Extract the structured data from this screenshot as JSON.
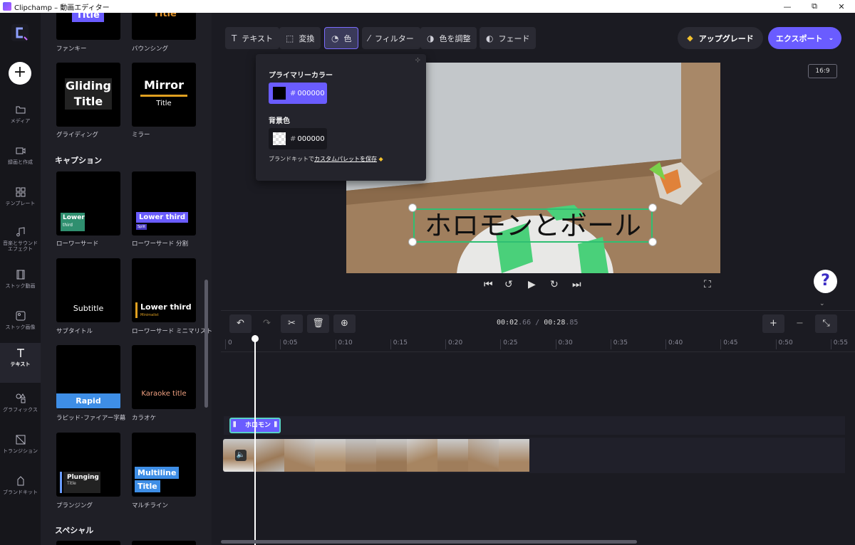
{
  "window": {
    "title": "Clipchamp – 動画エディター",
    "minimize": "—",
    "maximize": "⧉",
    "close": "✕"
  },
  "rail": {
    "add": "+",
    "items": [
      {
        "label": "メディア",
        "icon": "folder-icon"
      },
      {
        "label": "録画と作成",
        "icon": "video-camera-icon"
      },
      {
        "label": "テンプレート",
        "icon": "template-grid-icon"
      },
      {
        "label": "音楽とサウンド エフェクト",
        "icon": "music-note-icon"
      },
      {
        "label": "ストック動画",
        "icon": "film-icon"
      },
      {
        "label": "ストック画像",
        "icon": "image-icon"
      },
      {
        "label": "テキスト",
        "icon": "text-t-icon"
      },
      {
        "label": "グラフィックス",
        "icon": "shapes-icon"
      },
      {
        "label": "トランジション",
        "icon": "transition-icon"
      },
      {
        "label": "ブランドキット",
        "icon": "brand-kit-icon"
      }
    ]
  },
  "library": {
    "cards": [
      {
        "label": "ファンキー",
        "preview": "Title"
      },
      {
        "label": "バウンシング",
        "preview": "Title"
      },
      {
        "label": "グライディング",
        "preview": "Gliding Title"
      },
      {
        "label": "ミラー",
        "preview": "Mirror",
        "sub": "Title"
      },
      {
        "label": "ローワーサード",
        "preview": "Lower",
        "sub": "third"
      },
      {
        "label": "ローワーサード 分割",
        "preview": "Lower third",
        "sub": "Split"
      },
      {
        "label": "サブタイトル",
        "preview": "Subtitle"
      },
      {
        "label": "ローワーサード ミニマリスト",
        "preview": "Lower third",
        "sub": "Minimalist"
      },
      {
        "label": "ラピッド･ファイアー字幕",
        "preview": "Rapid"
      },
      {
        "label": "カラオケ",
        "preview": "Karaoke title"
      },
      {
        "label": "プランジング",
        "preview": "Plunging",
        "sub": "Title"
      },
      {
        "label": "マルチライン",
        "preview": "Multiline",
        "sub": "Title"
      }
    ],
    "section_captions": "キャプション",
    "section_special": "スペシャル"
  },
  "toolbar": {
    "text": "テキスト",
    "transform": "変換",
    "color": "色",
    "filter": "フィルター",
    "adjust": "色を調整",
    "fade": "フェード",
    "upgrade": "アップグレード",
    "export": "エクスポート"
  },
  "aspect_ratio": "16:9",
  "color_popover": {
    "primary_label": "プライマリーカラー",
    "primary_value": "000000",
    "background_label": "背景色",
    "background_value": "000000",
    "note_prefix": "ブランドキットで",
    "note_link": "カスタムパレットを保存"
  },
  "preview": {
    "overlay_text": "ホロモンとボール"
  },
  "timeline": {
    "current_time": "00:02",
    "current_frac": ".66",
    "total_time": "00:28",
    "total_frac": ".85",
    "ticks": [
      "0",
      "0:05",
      "0:10",
      "0:15",
      "0:20",
      "0:25",
      "0:30",
      "0:35",
      "0:40",
      "0:45",
      "0:50",
      "0:55"
    ],
    "text_clip": "ホロモン",
    "playhead_seconds": 2.66
  },
  "colors": {
    "accent": "#6a5cff",
    "selection": "#2fbf72"
  }
}
